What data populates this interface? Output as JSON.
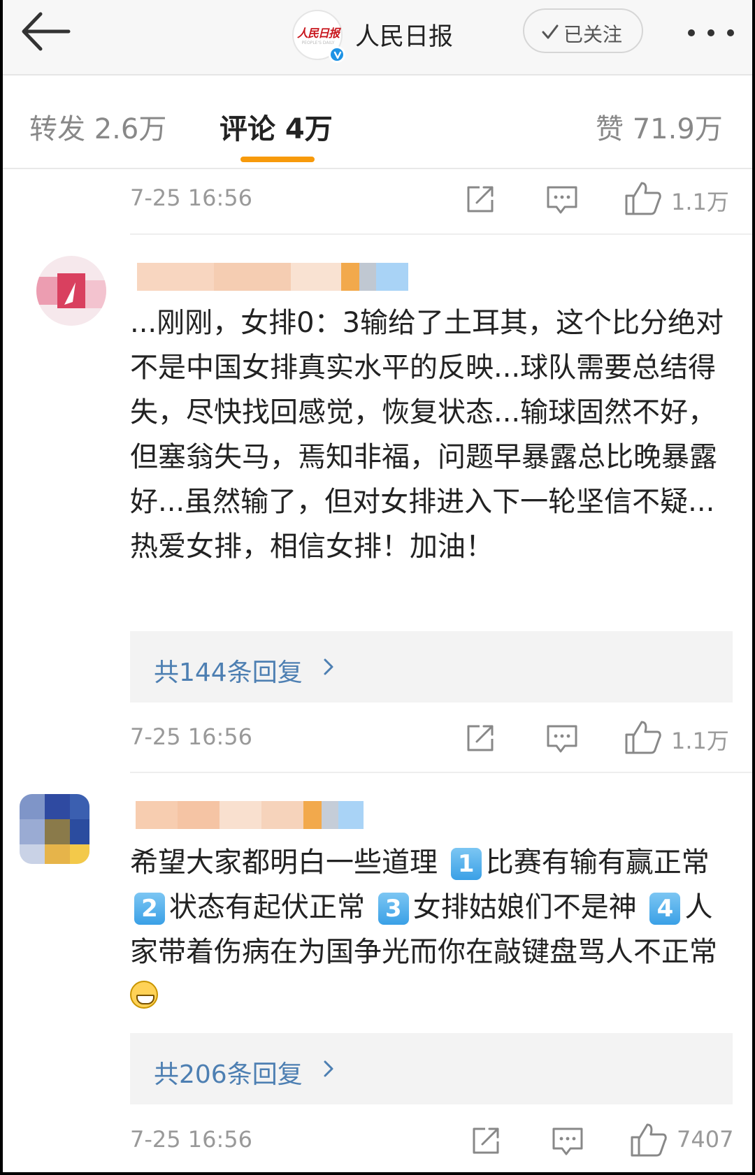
{
  "header": {
    "account_name": "人民日报",
    "logo_text": "人民日报",
    "logo_sub": "PEOPLE'S DAILY",
    "follow_label": "已关注"
  },
  "tabs": {
    "repost": "转发 2.6万",
    "comments": "评论 4万",
    "likes": "赞 71.9万"
  },
  "rows": [
    {
      "time": "7-25 16:56",
      "likes": "1.1万"
    },
    {
      "time": "7-25 16:56",
      "likes": "1.1万"
    },
    {
      "time": "7-25 16:56",
      "likes": "7407"
    }
  ],
  "comments": [
    {
      "text": "...刚刚，女排0：3输给了土耳其，这个比分绝对不是中国女排真实水平的反映...球队需要总结得失，尽快找回感觉，恢复状态...输球固然不好，但塞翁失马，焉知非福，问题早暴露总比晚暴露好...虽然输了，但对女排进入下一轮坚信不疑...热爱女排，相信女排！加油！",
      "replies": "共144条回复"
    },
    {
      "text_parts": [
        "希望大家都明白一些道理",
        "1",
        "比赛有输有赢正常",
        "2",
        "状态有起伏正常",
        "3",
        "女排姑娘们不是神",
        "4",
        "人家带着伤病在为国争光而你在敲键盘骂人不正常"
      ],
      "emoji": "grinning-face",
      "replies": "共206条回复"
    }
  ],
  "colors": {
    "accent_indicator": "#f79a0b",
    "link_blue": "#4d7fb2",
    "verified_blue": "#1e93e5",
    "logo_red": "#c8161d"
  },
  "icons": [
    "back-arrow-icon",
    "verified-icon",
    "checkmark-icon",
    "more-dots-icon",
    "share-icon",
    "comment-icon",
    "like-icon",
    "chevron-right-icon"
  ]
}
